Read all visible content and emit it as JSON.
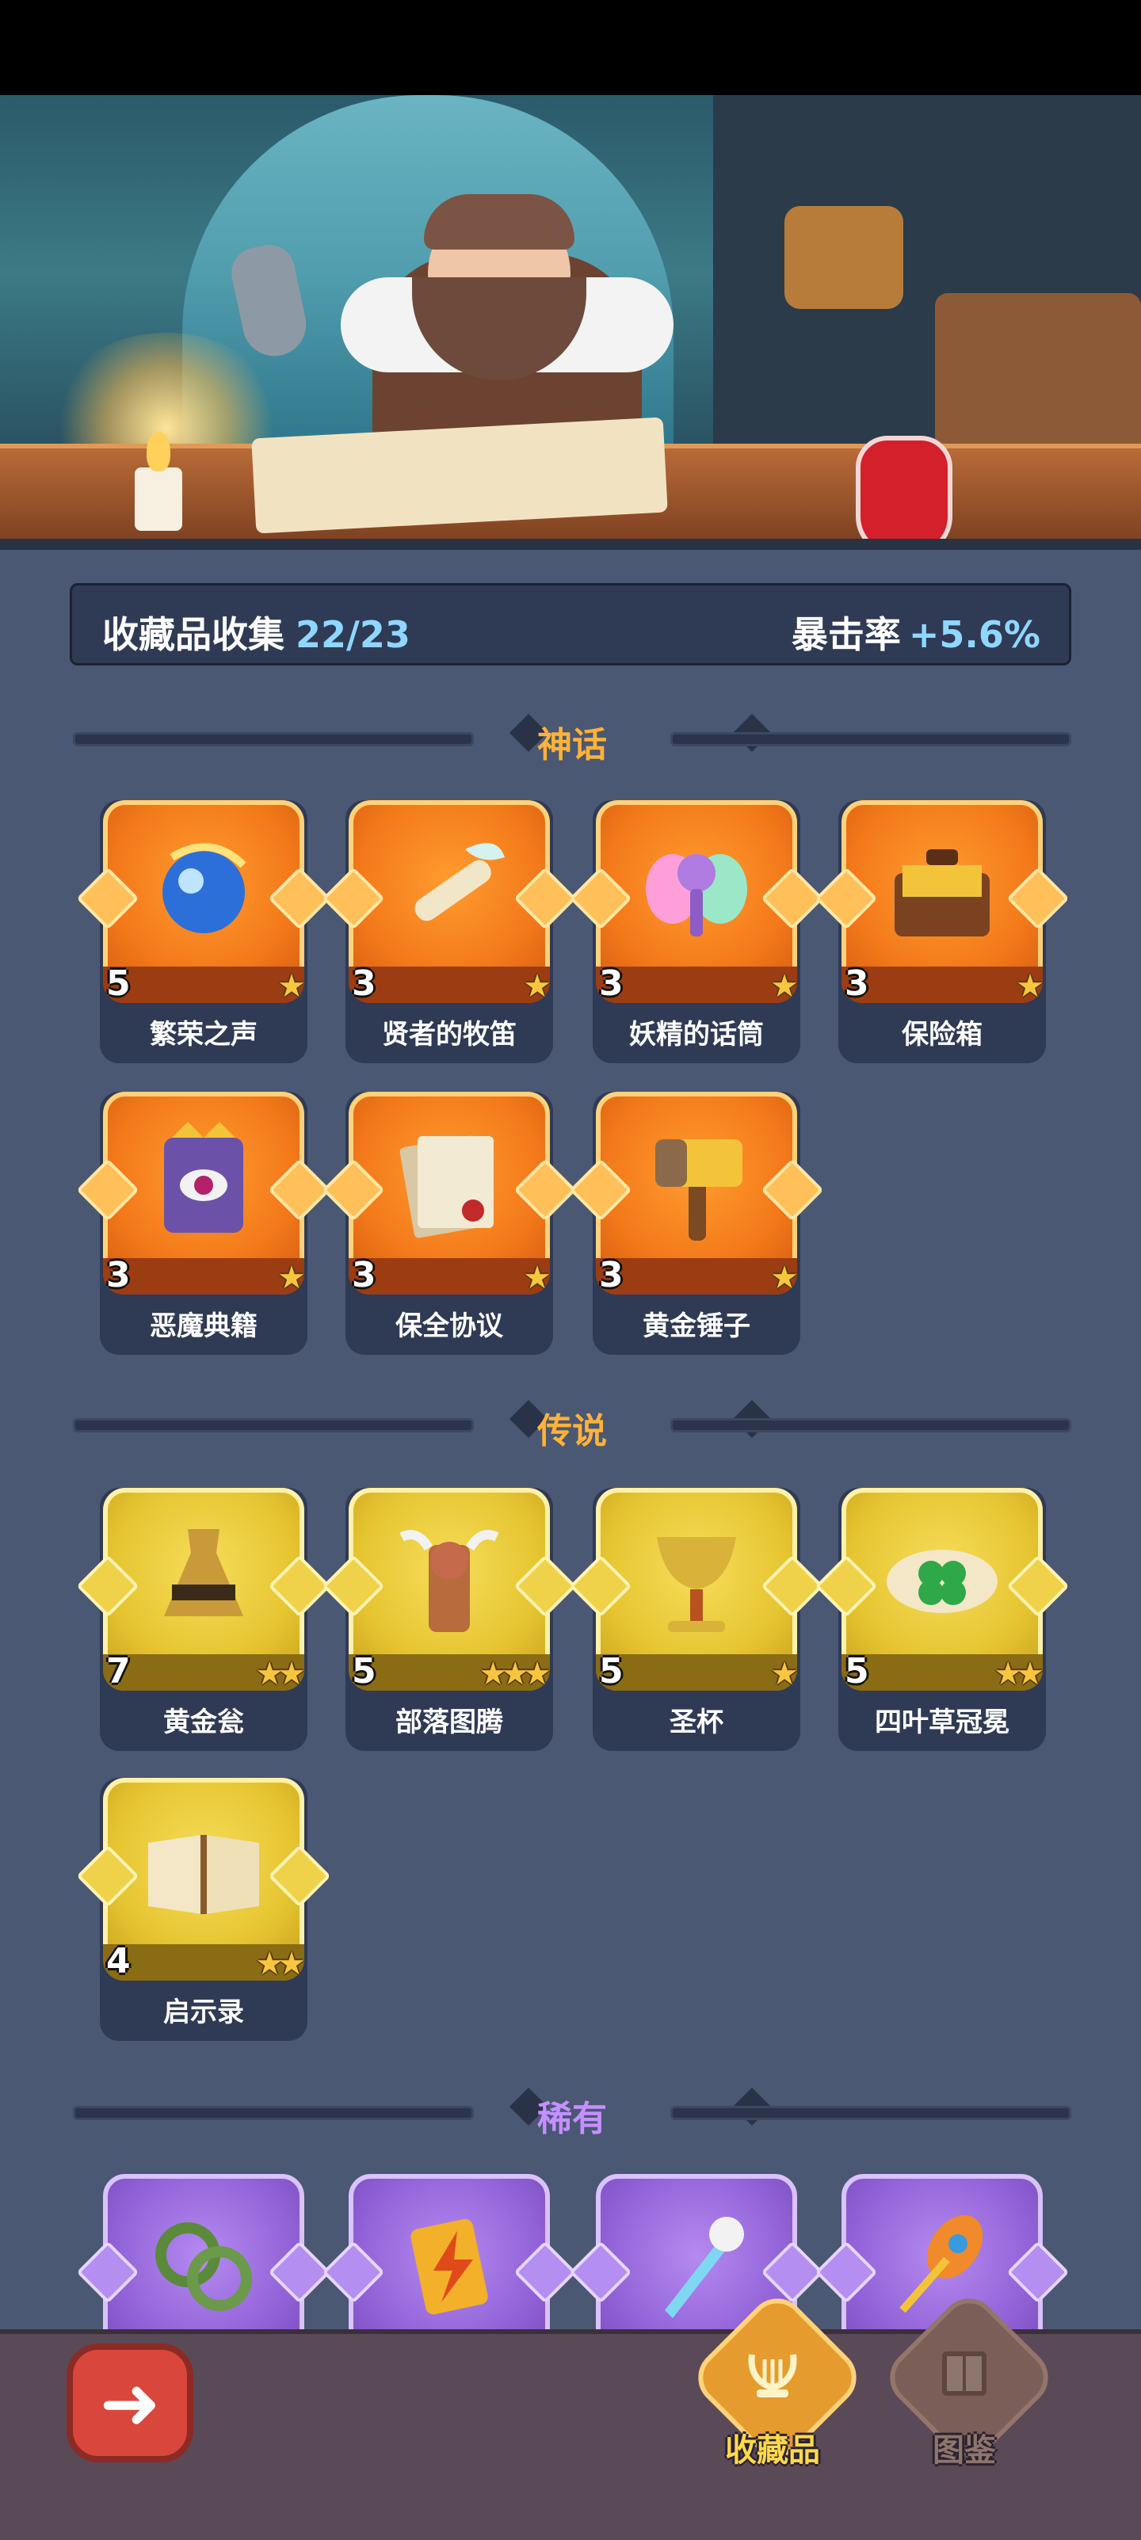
{
  "summary": {
    "label": "收藏品收集",
    "count": "22/23",
    "stat_label": "暴击率",
    "stat_value": "+5.6%"
  },
  "sections": {
    "mythic": {
      "title": "神话",
      "color": "#ffb23a",
      "items": [
        {
          "name": "繁荣之声",
          "level": "5",
          "stars": "★",
          "icon": "blue-orb-icon"
        },
        {
          "name": "贤者的牧笛",
          "level": "3",
          "stars": "★",
          "icon": "flute-icon"
        },
        {
          "name": "妖精的话筒",
          "level": "3",
          "stars": "★",
          "icon": "fairy-microphone-icon"
        },
        {
          "name": "保险箱",
          "level": "3",
          "stars": "★",
          "icon": "treasure-chest-icon"
        },
        {
          "name": "恶魔典籍",
          "level": "3",
          "stars": "★",
          "icon": "demon-book-icon"
        },
        {
          "name": "保全协议",
          "level": "3",
          "stars": "★",
          "icon": "scroll-icon"
        },
        {
          "name": "黄金锤子",
          "level": "3",
          "stars": "★",
          "icon": "golden-hammer-icon"
        }
      ]
    },
    "legend": {
      "title": "传说",
      "color": "#ffb23a",
      "items": [
        {
          "name": "黄金瓮",
          "level": "7",
          "stars": "★★",
          "icon": "golden-vase-icon"
        },
        {
          "name": "部落图腾",
          "level": "5",
          "stars": "★★★",
          "icon": "tribal-totem-icon"
        },
        {
          "name": "圣杯",
          "level": "5",
          "stars": "★",
          "icon": "grail-icon"
        },
        {
          "name": "四叶草冠冕",
          "level": "5",
          "stars": "★★",
          "icon": "clover-crown-icon"
        },
        {
          "name": "启示录",
          "level": "4",
          "stars": "★★",
          "icon": "open-book-icon"
        }
      ]
    },
    "rare": {
      "title": "稀有",
      "color": "#c490ff",
      "items": [
        {
          "icon": "vine-ring-icon"
        },
        {
          "icon": "lightning-card-icon"
        },
        {
          "icon": "ice-dagger-icon"
        },
        {
          "icon": "flame-feather-icon"
        }
      ]
    }
  },
  "nav": {
    "back_icon": "back-arrow-icon",
    "tabs": [
      {
        "label": "收藏品",
        "icon": "lyre-icon",
        "active": true
      },
      {
        "label": "图鉴",
        "icon": "book-icon",
        "active": false
      }
    ]
  }
}
